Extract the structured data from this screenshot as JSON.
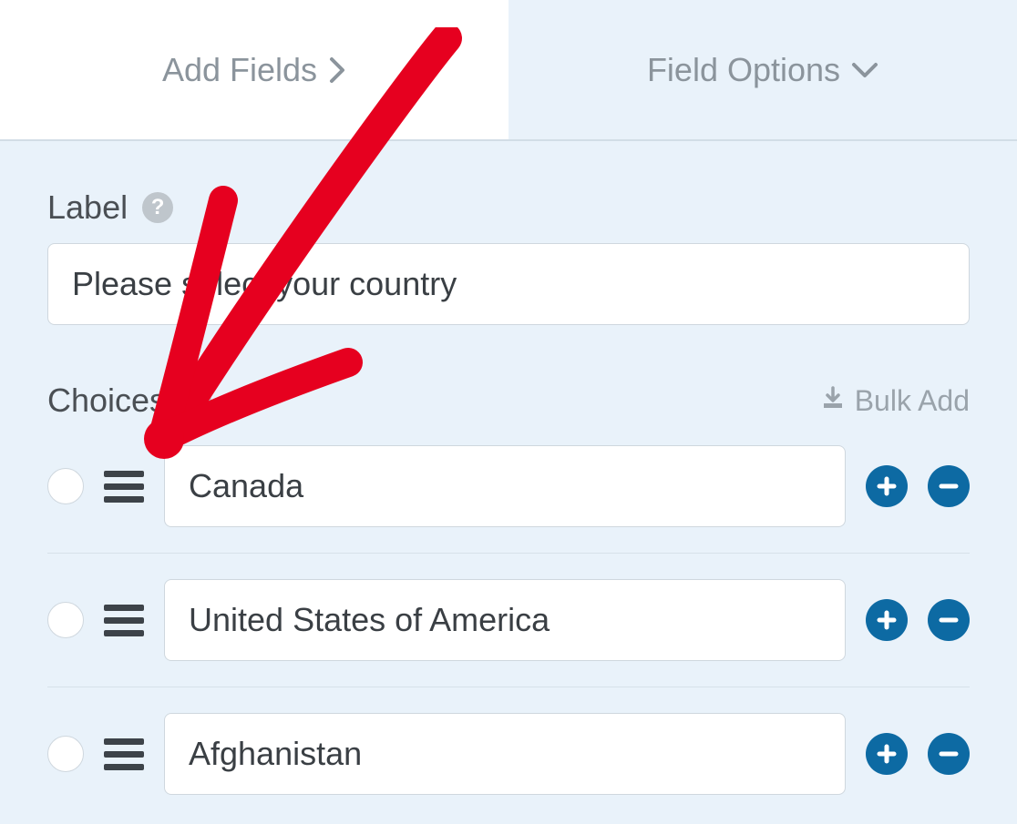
{
  "tabs": {
    "add_fields": "Add Fields",
    "field_options": "Field Options"
  },
  "label_section": {
    "title": "Label",
    "value": "Please select your country"
  },
  "choices_section": {
    "title": "Choices",
    "bulk_add": "Bulk Add"
  },
  "choices": [
    {
      "value": "Canada"
    },
    {
      "value": "United States of America"
    },
    {
      "value": "Afghanistan"
    }
  ]
}
